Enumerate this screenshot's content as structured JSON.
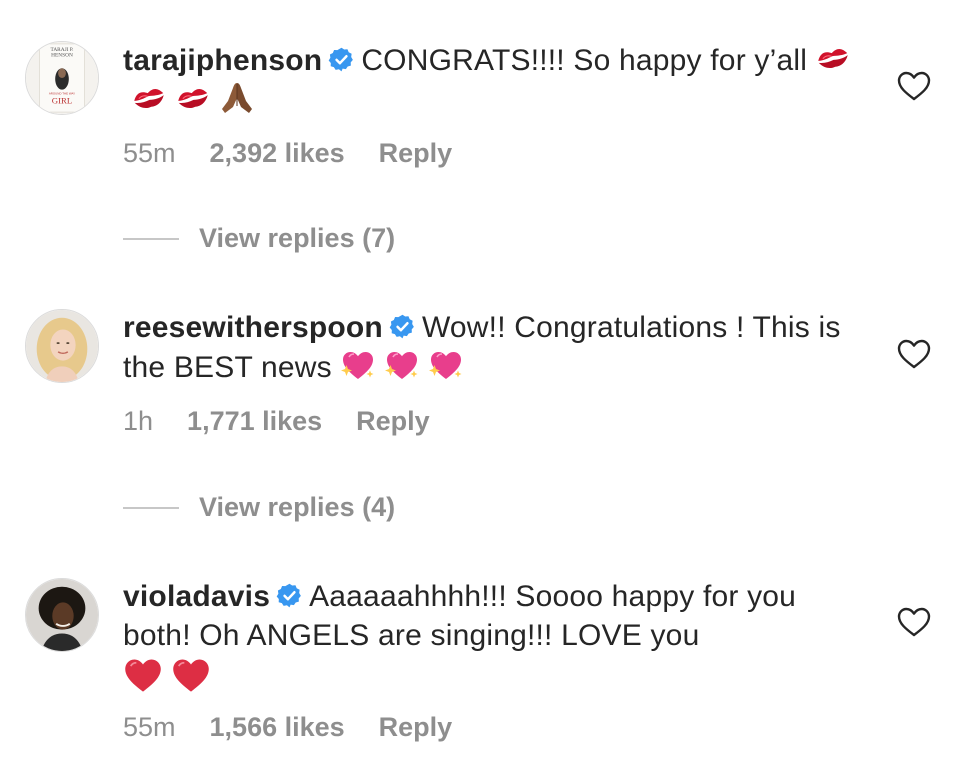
{
  "comments": [
    {
      "username": "tarajiphenson",
      "text": "CONGRATS!!!! So happy for y’all",
      "emojis": [
        "kiss-mark",
        "kiss-mark",
        "kiss-mark",
        "folded-hands"
      ],
      "avatar_label": {
        "top": "TARAJI P.",
        "mid": "HENSON",
        "bottom": "GIRL",
        "tagline": "AROUND THE WAY"
      },
      "time": "55m",
      "likes": "2,392 likes",
      "reply_label": "Reply",
      "view_replies": "View replies (7)"
    },
    {
      "username": "reesewitherspoon",
      "text": "Wow!! Congratulations ! This is the BEST news",
      "emojis": [
        "sparkling-heart",
        "sparkling-heart",
        "sparkling-heart"
      ],
      "time": "1h",
      "likes": "1,771 likes",
      "reply_label": "Reply",
      "view_replies": "View replies (4)"
    },
    {
      "username": "violadavis",
      "text": "Aaaaaahhhh!!! Soooo happy for you both! Oh ANGELS are singing!!! LOVE you",
      "emojis": [
        "red-heart",
        "red-heart"
      ],
      "time": "55m",
      "likes": "1,566 likes",
      "reply_label": "Reply"
    }
  ],
  "colors": {
    "text": "#262626",
    "secondary": "#8e8e8e",
    "verified": "#3897f0",
    "divider": "#c7c7c7"
  }
}
